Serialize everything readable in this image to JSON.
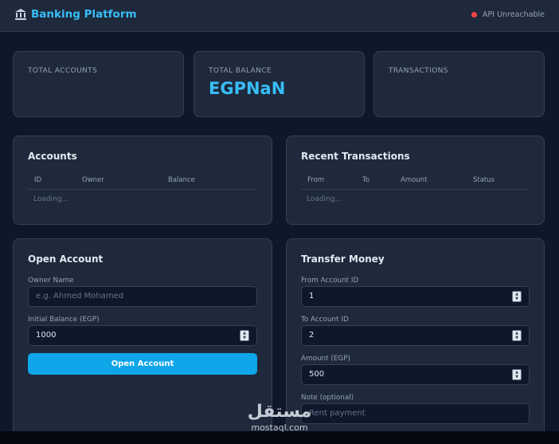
{
  "header": {
    "title": "Banking Platform",
    "status_text": "API Unreachable",
    "status_color": "#ef4444"
  },
  "stats": [
    {
      "label": "TOTAL ACCOUNTS",
      "value": ""
    },
    {
      "label": "TOTAL BALANCE",
      "value": "EGPNaN"
    },
    {
      "label": "TRANSACTIONS",
      "value": ""
    }
  ],
  "accounts": {
    "title": "Accounts",
    "columns": [
      "ID",
      "Owner",
      "Balance"
    ],
    "loading": "Loading..."
  },
  "transactions": {
    "title": "Recent Transactions",
    "columns": [
      "From",
      "To",
      "Amount",
      "Status"
    ],
    "loading": "Loading..."
  },
  "open_account": {
    "title": "Open Account",
    "owner_label": "Owner Name",
    "owner_placeholder": "e.g. Ahmed Mohamed",
    "balance_label": "Initial Balance (EGP)",
    "balance_value": "1000",
    "button": "Open Account"
  },
  "transfer": {
    "title": "Transfer Money",
    "from_label": "From Account ID",
    "from_value": "1",
    "to_label": "To Account ID",
    "to_value": "2",
    "amount_label": "Amount (EGP)",
    "amount_value": "500",
    "note_label": "Note (optional)",
    "note_placeholder": "Rent payment"
  },
  "watermark": {
    "arabic": "مستقل",
    "latin": "mostaql.com"
  },
  "colors": {
    "accent": "#38bdf8",
    "button": "#0ea5e9",
    "background": "#0f172a",
    "card": "#1e293b"
  }
}
